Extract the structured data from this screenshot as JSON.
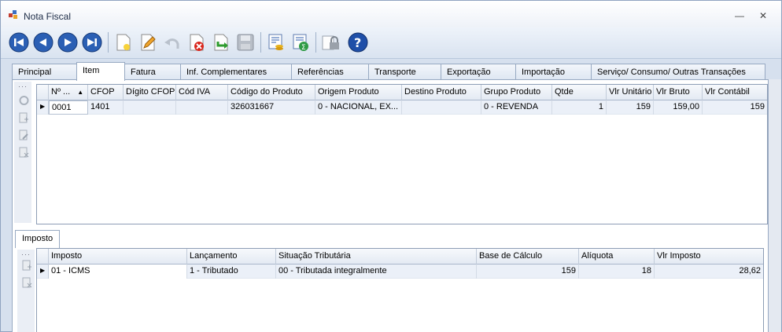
{
  "window": {
    "title": "Nota Fiscal",
    "minimize": "—",
    "close": "✕"
  },
  "toolbar": {
    "buttons": [
      {
        "name": "first-record",
        "icon": "skip-back-icon"
      },
      {
        "name": "previous-record",
        "icon": "arrow-left-icon"
      },
      {
        "name": "next-record",
        "icon": "arrow-right-icon"
      },
      {
        "name": "last-record",
        "icon": "skip-forward-icon"
      },
      {
        "name": "new",
        "icon": "new-document-icon"
      },
      {
        "name": "edit",
        "icon": "pencil-icon"
      },
      {
        "name": "undo",
        "icon": "undo-icon"
      },
      {
        "name": "delete",
        "icon": "delete-icon"
      },
      {
        "name": "import",
        "icon": "import-icon"
      },
      {
        "name": "save",
        "icon": "floppy-disk-icon"
      },
      {
        "name": "finance",
        "icon": "coins-document-icon"
      },
      {
        "name": "calculate",
        "icon": "sum-document-icon"
      },
      {
        "name": "lock",
        "icon": "lock-icon"
      },
      {
        "name": "help",
        "icon": "help-icon"
      }
    ]
  },
  "tabs": [
    {
      "label": "Principal",
      "active": false
    },
    {
      "label": "Item",
      "active": true
    },
    {
      "label": "Fatura",
      "active": false
    },
    {
      "label": "Inf. Complementares",
      "active": false
    },
    {
      "label": "Referências",
      "active": false
    },
    {
      "label": "Transporte",
      "active": false
    },
    {
      "label": "Exportação",
      "active": false
    },
    {
      "label": "Importação",
      "active": false
    },
    {
      "label": "Serviço/ Consumo/ Outras Transações",
      "active": false
    }
  ],
  "items_grid": {
    "columns": [
      "Nº ...",
      "CFOP",
      "Dígito CFOP",
      "Cód IVA",
      "Código do Produto",
      "Origem Produto",
      "Destino Produto",
      "Grupo Produto",
      "Qtde",
      "Vlr Unitário",
      "Vlr Bruto",
      "Vlr Contábil"
    ],
    "sort_indicator": "▲",
    "rows": [
      [
        "0001",
        "1401",
        "",
        "",
        "326031667",
        "0 - NACIONAL, EX...",
        "",
        "0 - REVENDA",
        "1",
        "159",
        "159,00",
        "159"
      ]
    ]
  },
  "sub_tab": {
    "label": "Imposto"
  },
  "tax_grid": {
    "columns": [
      "Imposto",
      "Lançamento",
      "Situação Tributária",
      "Base de Cálculo",
      "Alíquota",
      "Vlr Imposto"
    ],
    "rows": [
      [
        "01 - ICMS",
        "1 - Tributado",
        "00 - Tributada integralmente",
        "159",
        "18",
        "28,62"
      ]
    ]
  },
  "row_indicator": "▶",
  "side_dots": "···"
}
